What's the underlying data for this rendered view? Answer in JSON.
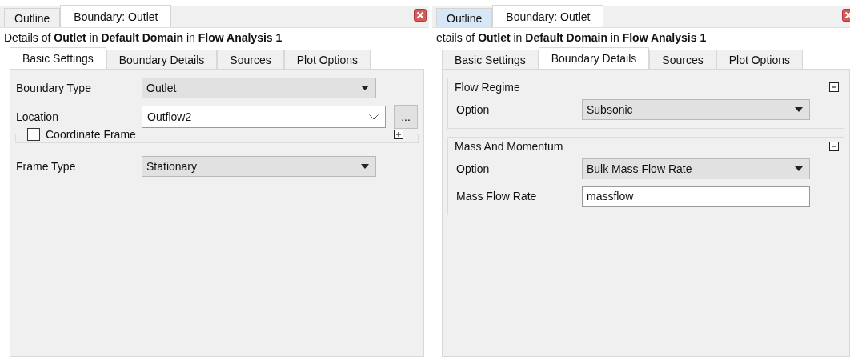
{
  "panels": [
    {
      "tabs": [
        {
          "label": "Outline",
          "selected": false,
          "hovered": false
        },
        {
          "label": "Boundary: Outlet",
          "selected": true,
          "hovered": false
        }
      ],
      "details": "Details of **Outlet** in **Default Domain** in **Flow Analysis 1**",
      "subtabs": [
        {
          "label": "Basic Settings",
          "selected": true
        },
        {
          "label": "Boundary Details",
          "selected": false
        },
        {
          "label": "Sources",
          "selected": false
        },
        {
          "label": "Plot Options",
          "selected": false
        }
      ],
      "items": [
        {
          "kind": "dropdown",
          "label": "Boundary Type",
          "value": "Outlet"
        },
        {
          "kind": "combo",
          "label": "Location",
          "value": "Outflow2",
          "button": "..."
        },
        {
          "kind": "group",
          "label": "Coordinate Frame",
          "checked": false,
          "expanded": false
        },
        {
          "kind": "dropdown",
          "label": "Frame Type",
          "value": "Stationary"
        }
      ]
    },
    {
      "tabs": [
        {
          "label": "Outline",
          "selected": false,
          "hovered": true
        },
        {
          "label": "Boundary: Outlet",
          "selected": true,
          "hovered": false
        }
      ],
      "details": "etails of **Outlet** in **Default Domain** in **Flow Analysis 1**",
      "subtabs": [
        {
          "label": "Basic Settings",
          "selected": false
        },
        {
          "label": "Boundary Details",
          "selected": true
        },
        {
          "label": "Sources",
          "selected": false
        },
        {
          "label": "Plot Options",
          "selected": false
        }
      ],
      "items": [
        {
          "kind": "group",
          "label": "Flow Regime",
          "expanded": true,
          "children": [
            {
              "kind": "dropdown",
              "label": "Option",
              "value": "Subsonic"
            }
          ]
        },
        {
          "kind": "group",
          "label": "Mass And Momentum",
          "expanded": true,
          "children": [
            {
              "kind": "dropdown",
              "label": "Option",
              "value": "Bulk Mass Flow Rate"
            },
            {
              "kind": "text",
              "label": "Mass Flow Rate",
              "value": "massflow"
            }
          ]
        }
      ]
    }
  ]
}
